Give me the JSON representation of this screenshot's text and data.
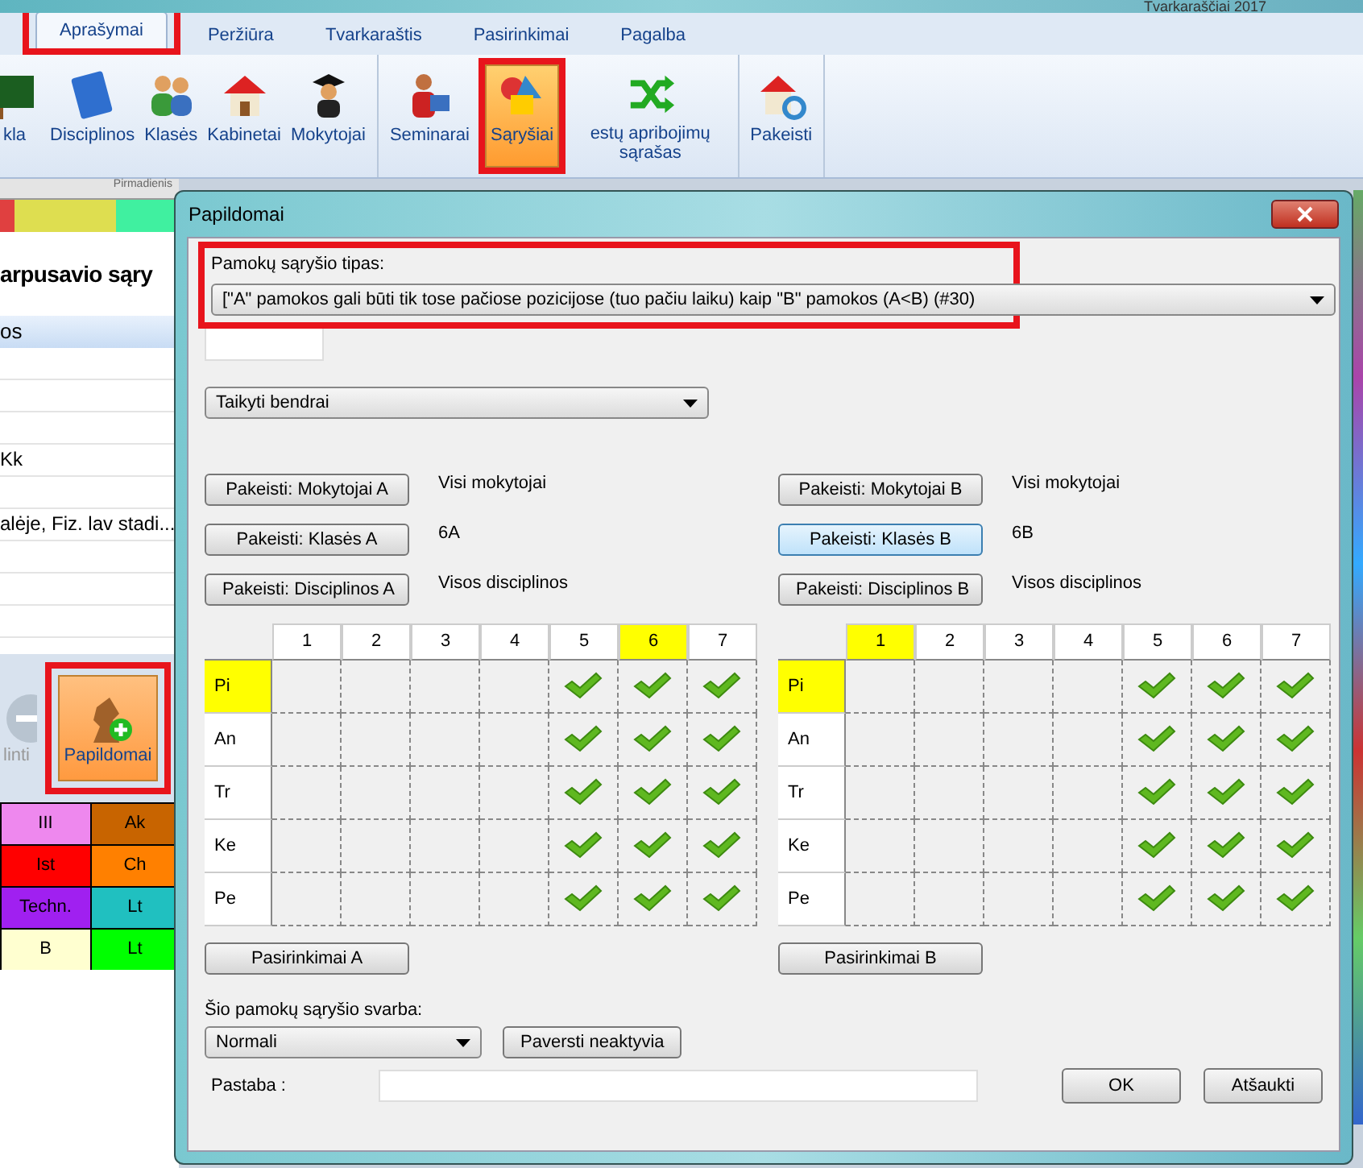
{
  "window": {
    "title": "Tvarkaraščiai 2017"
  },
  "tabs": [
    {
      "label": "Aprašymai",
      "selected": true,
      "highlighted": true
    },
    {
      "label": "Peržiūra",
      "selected": false
    },
    {
      "label": "Tvarkaraštis",
      "selected": false
    },
    {
      "label": "Pasirinkimai",
      "selected": false
    },
    {
      "label": "Pagalba",
      "selected": false
    }
  ],
  "ribbon": {
    "groups": [
      [
        {
          "label": "kla",
          "selected": false
        },
        {
          "label": "Disciplinos",
          "selected": false
        },
        {
          "label": "Klasės",
          "selected": false
        },
        {
          "label": "Kabinetai",
          "selected": false
        },
        {
          "label": "Mokytojai",
          "selected": false
        }
      ],
      [
        {
          "label": "Seminarai",
          "selected": false
        },
        {
          "label": "Sąryšiai",
          "selected": true,
          "highlighted": true
        },
        {
          "label": "estų apribojimų sąrašas",
          "selected": false
        }
      ],
      [
        {
          "label": "Pakeisti",
          "selected": false
        }
      ]
    ]
  },
  "background": {
    "day_header": "Pirmadienis",
    "heading": "arpusavio sąry",
    "column": "os",
    "rows": [
      "",
      "",
      "",
      "Kk",
      "",
      "alėje, Fiz. lav stadi...",
      "",
      "",
      ""
    ],
    "toolbar": [
      {
        "label": "linti",
        "disabled": true,
        "selected": false
      },
      {
        "label": "Papildomai",
        "disabled": false,
        "selected": true,
        "highlighted": true
      }
    ],
    "timetable": [
      [
        {
          "text": "III",
          "color": "#ee88ee"
        },
        {
          "text": "Ak",
          "color": "#c86400"
        }
      ],
      [
        {
          "text": "Ist",
          "color": "#ff0000"
        },
        {
          "text": "Ch",
          "color": "#ff8000"
        }
      ],
      [
        {
          "text": "Techn.",
          "color": "#a020f0"
        },
        {
          "text": "Lt",
          "color": "#20c0c0"
        }
      ],
      [
        {
          "text": "B",
          "color": "#ffffd0"
        },
        {
          "text": "Lt",
          "color": "#00ff00"
        }
      ]
    ]
  },
  "dialog": {
    "title": "Papildomai",
    "type_label": "Pamokų sąryšio tipas:",
    "type_highlighted": true,
    "type_value": "[\"A\" pamokos gali būti tik tose pačiose pozicijose (tuo pačiu laiku) kaip \"B\" pamokos (A<B) (#30)",
    "scope_value": "Taikyti bendrai",
    "sides": [
      {
        "buttons": [
          {
            "label": "Pakeisti: Mokytojai A",
            "value": "Visi mokytojai",
            "focused": false
          },
          {
            "label": "Pakeisti: Klasės A",
            "value": "6A",
            "focused": false
          },
          {
            "label": "Pakeisti: Disciplinos A",
            "value": "Visos disciplinos",
            "focused": false
          }
        ],
        "grid": {
          "columns": [
            {
              "label": "1",
              "selected": false
            },
            {
              "label": "2",
              "selected": false
            },
            {
              "label": "3",
              "selected": false
            },
            {
              "label": "4",
              "selected": false
            },
            {
              "label": "5",
              "selected": false
            },
            {
              "label": "6",
              "selected": true
            },
            {
              "label": "7",
              "selected": false
            }
          ],
          "rows": [
            {
              "label": "Pi",
              "selected": true,
              "cells": [
                false,
                false,
                false,
                false,
                true,
                true,
                true
              ]
            },
            {
              "label": "An",
              "selected": false,
              "cells": [
                false,
                false,
                false,
                false,
                true,
                true,
                true
              ]
            },
            {
              "label": "Tr",
              "selected": false,
              "cells": [
                false,
                false,
                false,
                false,
                true,
                true,
                true
              ]
            },
            {
              "label": "Ke",
              "selected": false,
              "cells": [
                false,
                false,
                false,
                false,
                true,
                true,
                true
              ]
            },
            {
              "label": "Pe",
              "selected": false,
              "cells": [
                false,
                false,
                false,
                false,
                true,
                true,
                true
              ]
            }
          ]
        },
        "options_button": "Pasirinkimai A"
      },
      {
        "buttons": [
          {
            "label": "Pakeisti: Mokytojai B",
            "value": "Visi mokytojai",
            "focused": false
          },
          {
            "label": "Pakeisti: Klasės B",
            "value": "6B",
            "focused": true
          },
          {
            "label": "Pakeisti: Disciplinos B",
            "value": "Visos disciplinos",
            "focused": false
          }
        ],
        "grid": {
          "columns": [
            {
              "label": "1",
              "selected": true
            },
            {
              "label": "2",
              "selected": false
            },
            {
              "label": "3",
              "selected": false
            },
            {
              "label": "4",
              "selected": false
            },
            {
              "label": "5",
              "selected": false
            },
            {
              "label": "6",
              "selected": false
            },
            {
              "label": "7",
              "selected": false
            }
          ],
          "rows": [
            {
              "label": "Pi",
              "selected": true,
              "cells": [
                false,
                false,
                false,
                false,
                true,
                true,
                true
              ]
            },
            {
              "label": "An",
              "selected": false,
              "cells": [
                false,
                false,
                false,
                false,
                true,
                true,
                true
              ]
            },
            {
              "label": "Tr",
              "selected": false,
              "cells": [
                false,
                false,
                false,
                false,
                true,
                true,
                true
              ]
            },
            {
              "label": "Ke",
              "selected": false,
              "cells": [
                false,
                false,
                false,
                false,
                true,
                true,
                true
              ]
            },
            {
              "label": "Pe",
              "selected": false,
              "cells": [
                false,
                false,
                false,
                false,
                true,
                true,
                true
              ]
            }
          ]
        },
        "options_button": "Pasirinkimai B"
      }
    ],
    "importance_label": "Šio pamokų sąryšio svarba:",
    "importance_value": "Normali",
    "deactivate_button": "Paversti neaktyvia",
    "note_label": "Pastaba :",
    "ok_button": "OK",
    "cancel_button": "Atšaukti"
  }
}
